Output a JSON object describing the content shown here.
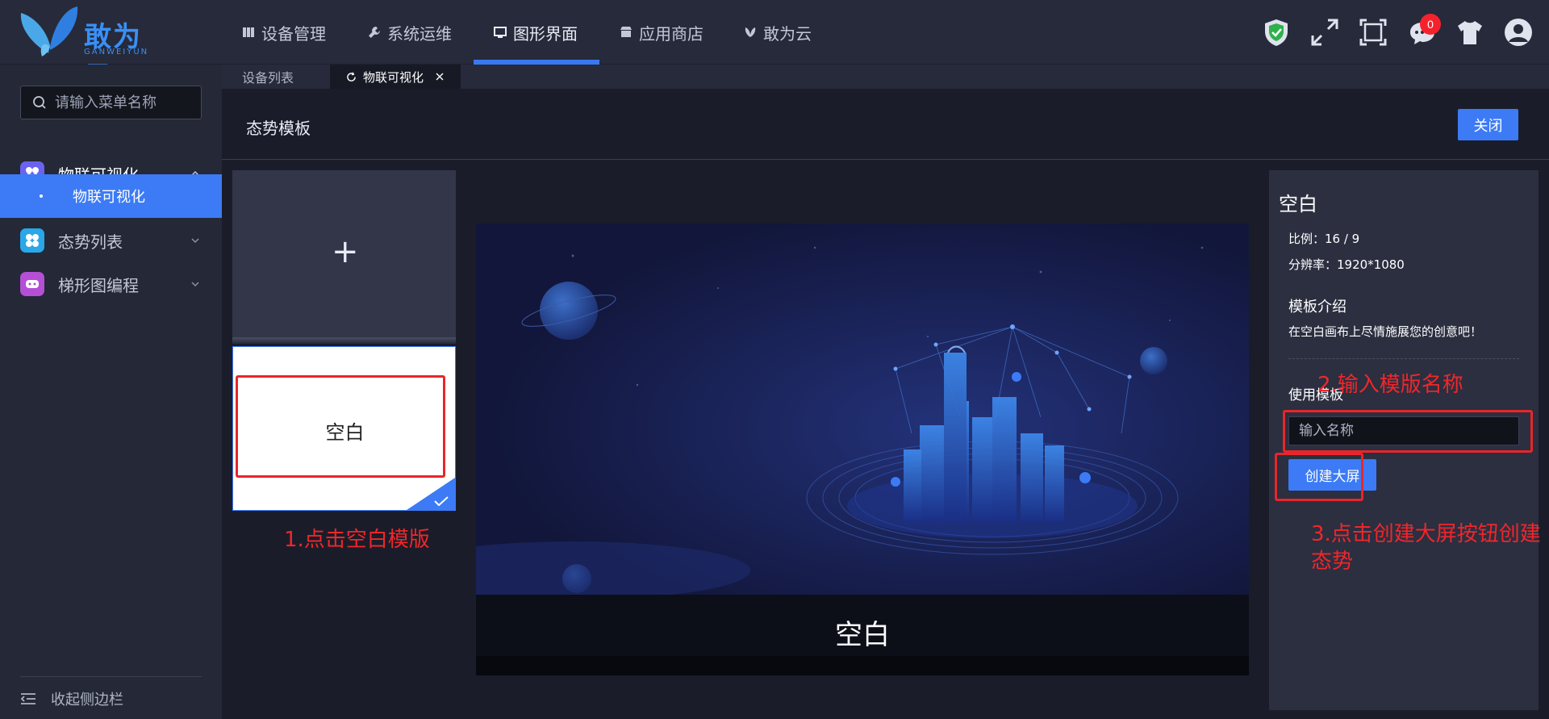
{
  "app": {
    "logo_text": "敢为云",
    "logo_sub": "GANWEIYUN"
  },
  "nav": {
    "tabs": [
      {
        "label": "设备管理",
        "icon": "device-icon"
      },
      {
        "label": "系统运维",
        "icon": "wrench-icon"
      },
      {
        "label": "图形界面",
        "icon": "screen-icon",
        "active": true
      },
      {
        "label": "应用商店",
        "icon": "store-icon"
      },
      {
        "label": "敢为云",
        "icon": "butterfly-icon"
      }
    ],
    "notification_count": "0",
    "top_icons": [
      "shield-check-icon",
      "fullscreen-expand-icon",
      "screen-frame-icon",
      "chat-icon",
      "tshirt-icon",
      "user-avatar-icon"
    ]
  },
  "sidebar": {
    "search_placeholder": "请输入菜单名称",
    "items": [
      {
        "label": "物联可视化",
        "icon": "flower-icon",
        "color": "#6b63f0",
        "expanded": true
      },
      {
        "label": "物联可视化",
        "sub": true,
        "active": true
      },
      {
        "label": "态势列表",
        "icon": "flower-icon",
        "color": "#2aa7e8"
      },
      {
        "label": "梯形图编程",
        "icon": "gamepad-icon",
        "color": "#b44fd6"
      }
    ],
    "collapse_label": "收起侧边栏"
  },
  "page_tabs": [
    {
      "label": "设备列表"
    },
    {
      "label": "物联可视化",
      "active": true,
      "closable": true
    }
  ],
  "content": {
    "title": "态势模板",
    "close_label": "关闭",
    "templates": {
      "add_symbol": "+",
      "blank_name": "空白"
    },
    "preview": {
      "caption": "空白"
    },
    "info": {
      "title": "空白",
      "ratio": "比例：16 / 9",
      "resolution": "分辨率：1920*1080",
      "intro_heading": "模板介绍",
      "intro_text": "在空白画布上尽情施展您的创意吧！",
      "use_heading": "使用模板",
      "name_placeholder": "输入名称",
      "create_label": "创建大屏"
    }
  },
  "annotations": {
    "step1": "1.点击空白模版",
    "step2": "2.输入模版名称",
    "step3": "3.点击创建大屏按钮创建态势"
  },
  "colors": {
    "accent": "#3c7bf5",
    "annotation": "#f0262a",
    "sidebar_bg": "#242837",
    "topbar_bg": "#262a3a"
  }
}
